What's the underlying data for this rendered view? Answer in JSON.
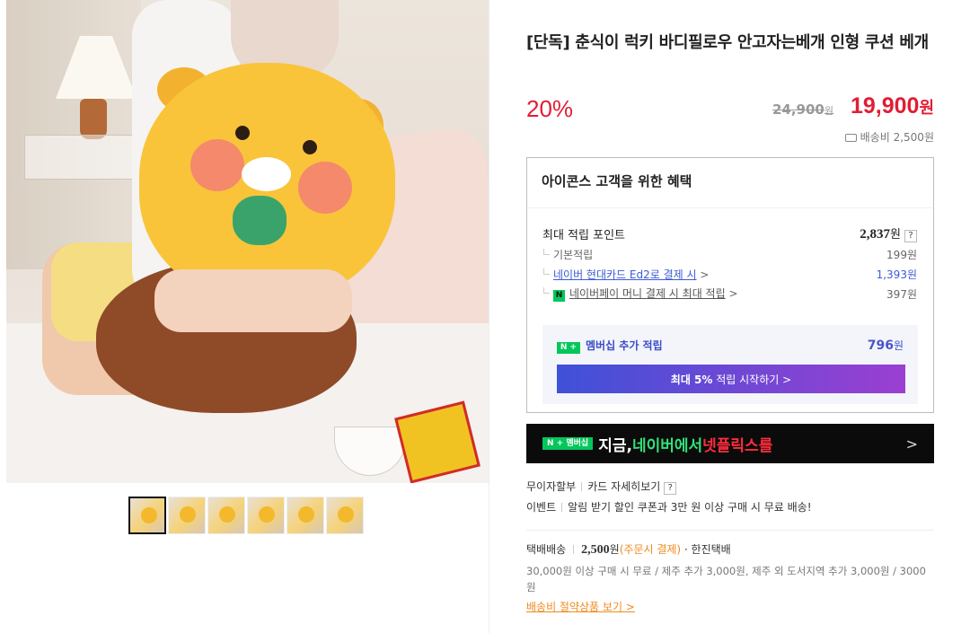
{
  "product": {
    "title": "[단독] 춘식이 럭키 바디필로우 안고자는베개 인형 쿠션 베개",
    "discount": "20%",
    "original_price": "24,900",
    "original_price_unit": "원",
    "sale_price": "19,900",
    "sale_price_unit": "원",
    "shipping_fee": "배송비 2,500원"
  },
  "gallery": {
    "thumbnail_count": 6,
    "active_thumbnail": 1
  },
  "benefits": {
    "title": "아이콘스 고객을 위한 혜택",
    "max_points_label": "최대 적립 포인트",
    "max_points_value": "2,837",
    "max_points_unit": "원",
    "help": "?",
    "rows": [
      {
        "label": "기본적립",
        "value": "199원"
      },
      {
        "label": "네이버 현대카드 Ed2로 결제 시",
        "value": "1,393원"
      },
      {
        "label": "네이버페이 머니 결제 시 최대 적립",
        "value": "397원"
      }
    ],
    "arrow": ">",
    "npay_icon": "N",
    "membership_tag": "N +",
    "membership_label": "멤버십 추가 적립",
    "membership_value": "796",
    "membership_unit": "원",
    "membership_button_bold": "최대 5%",
    "membership_button_rest": " 적립 시작하기 >"
  },
  "banner": {
    "tag": "N + 멤버십",
    "text_white": "지금, ",
    "text_green": "네이버에서 ",
    "text_red": "넷플릭스를",
    "arrow": ">"
  },
  "meta": {
    "installment": "무이자할부",
    "card_detail": "카드 자세히보기",
    "help": "?",
    "event_label": "이벤트",
    "event_text": "알림 받기 할인 쿠폰과 3만 원 이상 구매 시 무료 배송!"
  },
  "delivery": {
    "method": "택배배송",
    "fee": "2,500",
    "fee_unit": "원",
    "payment": "(주문시 결제)",
    "courier": " · 한진택배",
    "description": "30,000원 이상 구매 시 무료 / 제주 추가 3,000원, 제주 외 도서지역 추가 3,000원 / 3000원",
    "save_link": "배송비 절약상품 보기 >"
  },
  "colors": {
    "accent_red": "#e21d34",
    "naver_green": "#03c75a",
    "membership_blue": "#3b4cc7",
    "orange": "#f08a1e"
  }
}
